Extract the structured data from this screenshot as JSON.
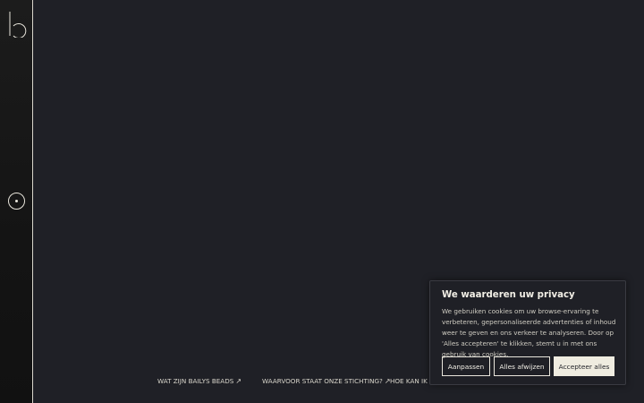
{
  "sidebar": {
    "logo_icon": "stylized-b-logo",
    "menu_icon": "circle-dot-icon"
  },
  "nav": {
    "items": [
      {
        "label": "WAT ZIJN BAILYS BEADS",
        "icon": "arrow-up-right-icon"
      },
      {
        "label": "WAARVOOR STAAT ONZE STICHTING?",
        "icon": "arrow-up-right-icon"
      },
      {
        "label": "HOE KAN IK EE"
      }
    ]
  },
  "cookie": {
    "title": "We waarderen uw privacy",
    "text": "We gebruiken cookies om uw browse-ervaring te verbeteren, gepersonaliseerde advertenties of inhoud weer te geven en ons verkeer te analyseren. Door op 'Alles accepteren' te klikken, stemt u in met ons gebruik van cookies.",
    "customize_label": "Aanpassen",
    "reject_label": "Alles afwijzen",
    "accept_label": "Accepteer alles",
    "accent_color": "#efece0"
  },
  "colors": {
    "background": "#1f2026",
    "sidebar": "#151515",
    "text": "#e9e6dc"
  }
}
